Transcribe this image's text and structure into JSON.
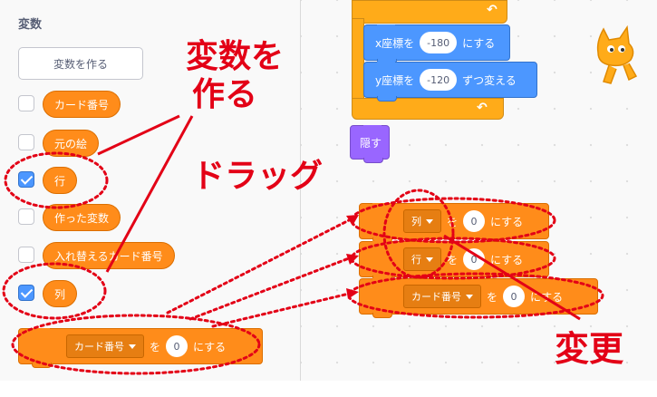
{
  "palette": {
    "category_title": "変数",
    "make_variable_label": "変数を作る",
    "variables": [
      {
        "label": "カード番号",
        "checked": false
      },
      {
        "label": "元の絵",
        "checked": false
      },
      {
        "label": "行",
        "checked": true
      },
      {
        "label": "作った変数",
        "checked": false
      },
      {
        "label": "入れ替えるカード番号",
        "checked": false
      },
      {
        "label": "列",
        "checked": true
      }
    ],
    "set_block": {
      "variable": "カード番号",
      "word": "を",
      "value": "0",
      "suffix": "にする"
    }
  },
  "workspace": {
    "set_x": {
      "label": "x座標を",
      "value": "-180",
      "suffix": "にする"
    },
    "change_y": {
      "label": "y座標を",
      "value": "-120",
      "suffix": "ずつ変える"
    },
    "hide_label": "隠す",
    "set_blocks": [
      {
        "variable": "列",
        "word": "を",
        "value": "0",
        "suffix": "にする"
      },
      {
        "variable": "行",
        "word": "を",
        "value": "0",
        "suffix": "にする"
      },
      {
        "variable": "カード番号",
        "word": "を",
        "value": "0",
        "suffix": "にする"
      }
    ]
  },
  "annotations": {
    "make_var_line1": "変数を",
    "make_var_line2": "作る",
    "drag": "ドラッグ",
    "change": "変更"
  },
  "colors": {
    "variables": "#ff8c1a",
    "motion": "#4c97ff",
    "looks": "#9966ff",
    "control": "#ffab19",
    "annotation": "#e30016"
  },
  "icons": [
    "loop-arrow-icon",
    "checkmark-icon",
    "dropdown-caret-icon",
    "scratch-cat-sprite"
  ]
}
